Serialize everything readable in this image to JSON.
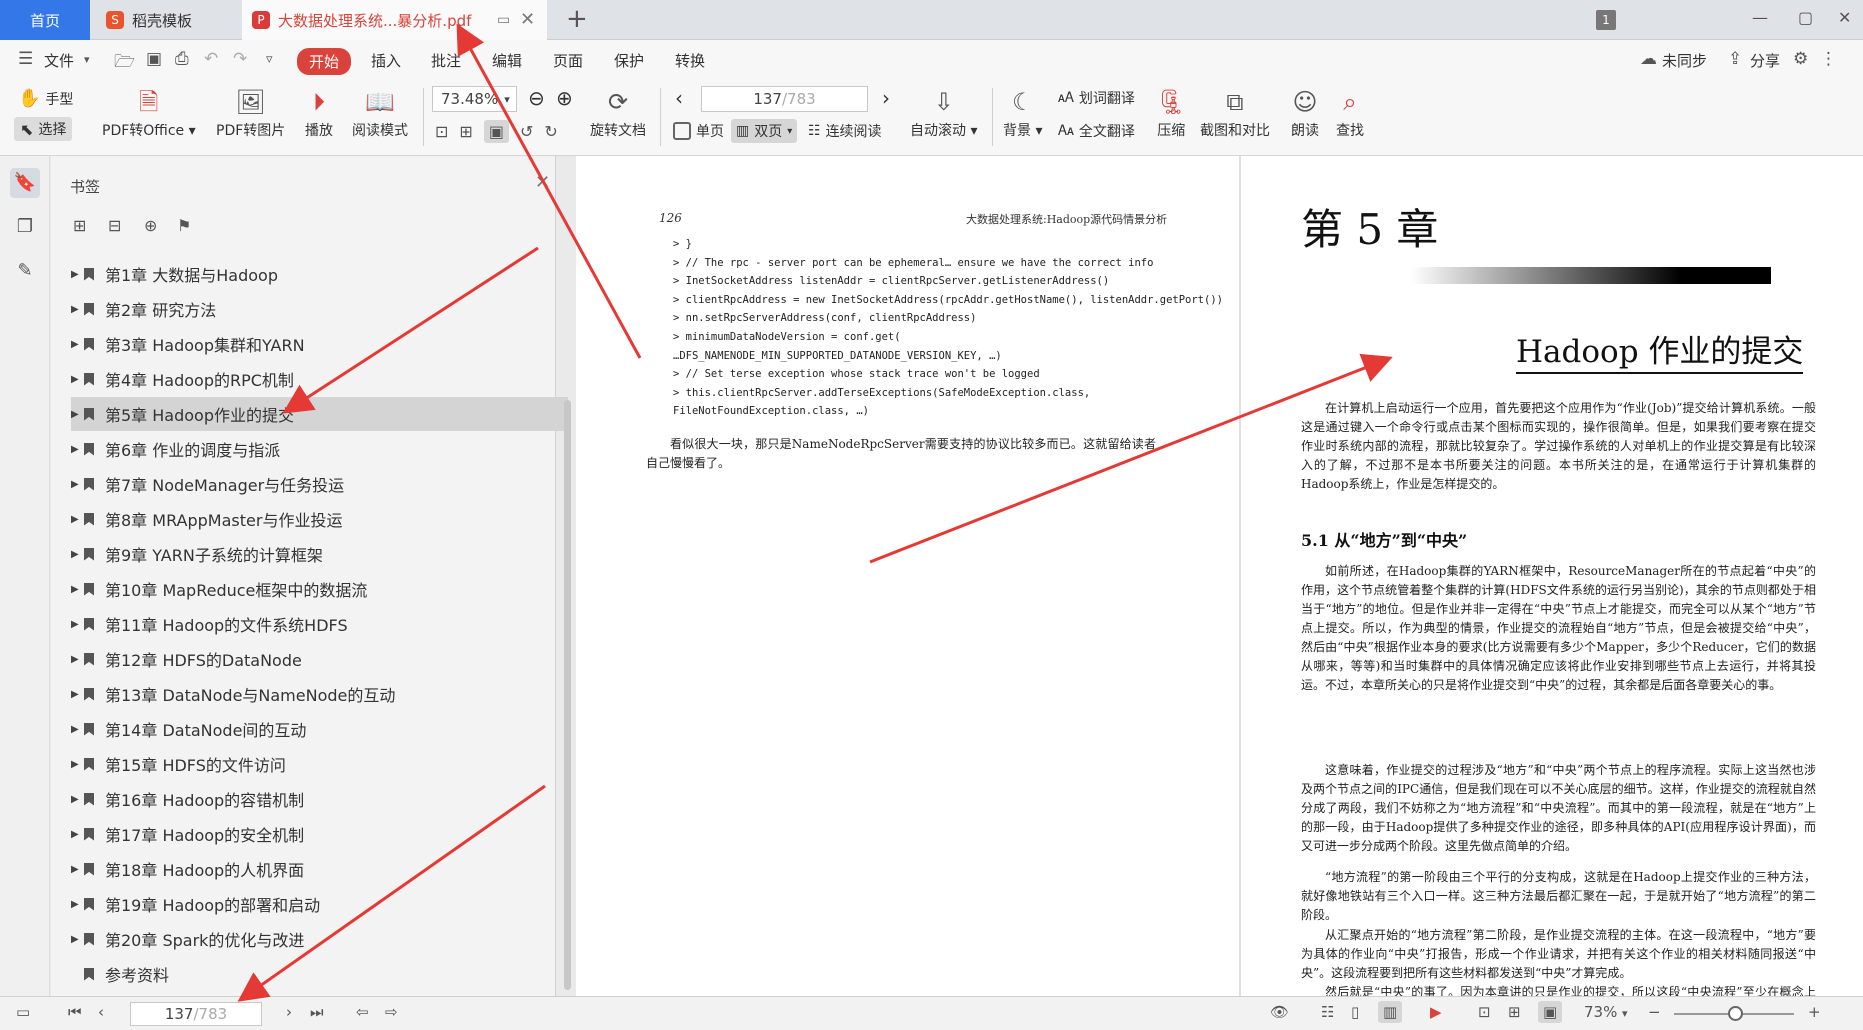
{
  "tabs": {
    "home": "首页",
    "template": "稻壳模板",
    "document": "大数据处理系统...暴分析.pdf",
    "window_count": "1"
  },
  "menu": {
    "file": "文件",
    "items": [
      "开始",
      "插入",
      "批注",
      "编辑",
      "页面",
      "保护",
      "转换"
    ],
    "unsynced": "未同步",
    "share": "分享"
  },
  "toolbar": {
    "hand": "手型",
    "select": "选择",
    "pdf_to_office": "PDF转Office",
    "pdf_to_image": "PDF转图片",
    "play": "播放",
    "read_mode": "阅读模式",
    "zoom_value": "73.48%",
    "rotate": "旋转文档",
    "page_current": "137",
    "page_total": "/783",
    "single": "单页",
    "double": "双页",
    "continuous": "连续阅读",
    "auto_scroll": "自动滚动",
    "background": "背景",
    "word_translate": "划词翻译",
    "full_translate": "全文翻译",
    "compress": "压缩",
    "screenshot_compare": "截图和对比",
    "read_aloud": "朗读",
    "find": "查找"
  },
  "bookmarks": {
    "title": "书签",
    "items": [
      "第1章 大数据与Hadoop",
      "第2章 研究方法",
      "第3章 Hadoop集群和YARN",
      "第4章 Hadoop的RPC机制",
      "第5章 Hadoop作业的提交",
      "第6章 作业的调度与指派",
      "第7章 NodeManager与任务投运",
      "第8章 MRAppMaster与作业投运",
      "第9章 YARN子系统的计算框架",
      "第10章 MapReduce框架中的数据流",
      "第11章 Hadoop的文件系统HDFS",
      "第12章 HDFS的DataNode",
      "第13章 DataNode与NameNode的互动",
      "第14章 DataNode间的互动",
      "第15章 HDFS的文件访问",
      "第16章 Hadoop的容错机制",
      "第17章 Hadoop的安全机制",
      "第18章 Hadoop的人机界面",
      "第19章 Hadoop的部署和启动",
      "第20章 Spark的优化与改进",
      "参考资料"
    ],
    "selected_index": 4
  },
  "left_page": {
    "page_number": "126",
    "running_head": "大数据处理系统:Hadoop源代码情景分析",
    "code": [
      "> }",
      "> // The rpc - server port can be ephemeral… ensure we have the correct info",
      "> InetSocketAddress listenAddr = clientRpcServer.getListenerAddress()",
      "> clientRpcAddress = new InetSocketAddress(rpcAddr.getHostName(), listenAddr.getPort())",
      "> nn.setRpcServerAddress(conf, clientRpcAddress)",
      "> minimumDataNodeVersion = conf.get(",
      "                    …DFS_NAMENODE_MIN_SUPPORTED_DATANODE_VERSION_KEY, …)",
      "> // Set terse exception whose stack trace won't be logged",
      "> this.clientRpcServer.addTerseExceptions(SafeModeException.class,",
      "                                       FileNotFoundException.class, …)"
    ],
    "text": "看似很大一块，那只是NameNodeRpcServer需要支持的协议比较多而已。这就留给读者自己慢慢看了。"
  },
  "right_page": {
    "chapter_number": "第 5 章",
    "chapter_title": "Hadoop 作业的提交",
    "intro": "在计算机上启动运行一个应用，首先要把这个应用作为“作业(Job)”提交给计算机系统。一般这是通过键入一个命令行或点击某个图标而实现的，操作很简单。但是，如果我们要考察在提交作业时系统内部的流程，那就比较复杂了。学过操作系统的人对单机上的作业提交算是有比较深入的了解，不过那不是本书所要关注的问题。本书所关注的是，在通常运行于计算机集群的Hadoop系统上，作业是怎样提交的。",
    "section": "5.1 从“地方”到“中央”",
    "paragraphs": [
      "如前所述，在Hadoop集群的YARN框架中，ResourceManager所在的节点起着“中央”的作用，这个节点统管着整个集群的计算(HDFS文件系统的运行另当别论)，其余的节点则都处于相当于“地方”的地位。但是作业并非一定得在“中央”节点上才能提交，而完全可以从某个“地方”节点上提交。所以，作为典型的情景，作业提交的流程始自“地方”节点，但是会被提交给“中央”，然后由“中央”根据作业本身的要求(比方说需要有多少个Mapper，多少个Reducer，它们的数据从哪来，等等)和当时集群中的具体情况确定应该将此作业安排到哪些节点上去运行，并将其投运。不过，本章所关心的只是将作业提交到“中央”的过程，其余都是后面各章要关心的事。",
      "这意味着，作业提交的过程涉及“地方”和“中央”两个节点上的程序流程。实际上这当然也涉及两个节点之间的IPC通信，但是我们现在可以不关心底层的细节。这样，作业提交的流程就自然分成了两段，我们不妨称之为“地方流程”和“中央流程”。而其中的第一段流程，就是在“地方”上的那一段，由于Hadoop提供了多种提交作业的途径，即多种具体的API(应用程序设计界面)，而又可进一步分成两个阶段。这里先做点简单的介绍。",
      "“地方流程”的第一阶段由三个平行的分支构成，这就是在Hadoop上提交作业的三种方法，就好像地铁站有三个入口一样。这三种方法最后都汇聚在一起，于是就开始了“地方流程”的第二阶段。",
      "从汇聚点开始的“地方流程”第二阶段，是作业提交流程的主体。在这一段流程中，“地方”要为具体的作业向“中央”打报告，形成一个作业请求，并把有关这个作业的相关材料随同报送“中央”。这段流程要到把所有这些材料都发送到“中央”才算完成。",
      "然后就是“中央”的事了。因为本章讲的只是作业的提交，所以这段“中央流程”至少在概念上是比较简单的，只是为这个作业“立案”，并将其排入一个队列，这就完成了作业的提交。至于对这个作业请求的处理，那是后面调度和指派的事了。"
    ]
  },
  "status": {
    "page_current": "137",
    "page_total": "/783",
    "zoom": "73%"
  },
  "colors": {
    "accent_red": "#d9433b",
    "home_tab_blue": "#3477e8",
    "annotation_arrow": "#e53935"
  }
}
